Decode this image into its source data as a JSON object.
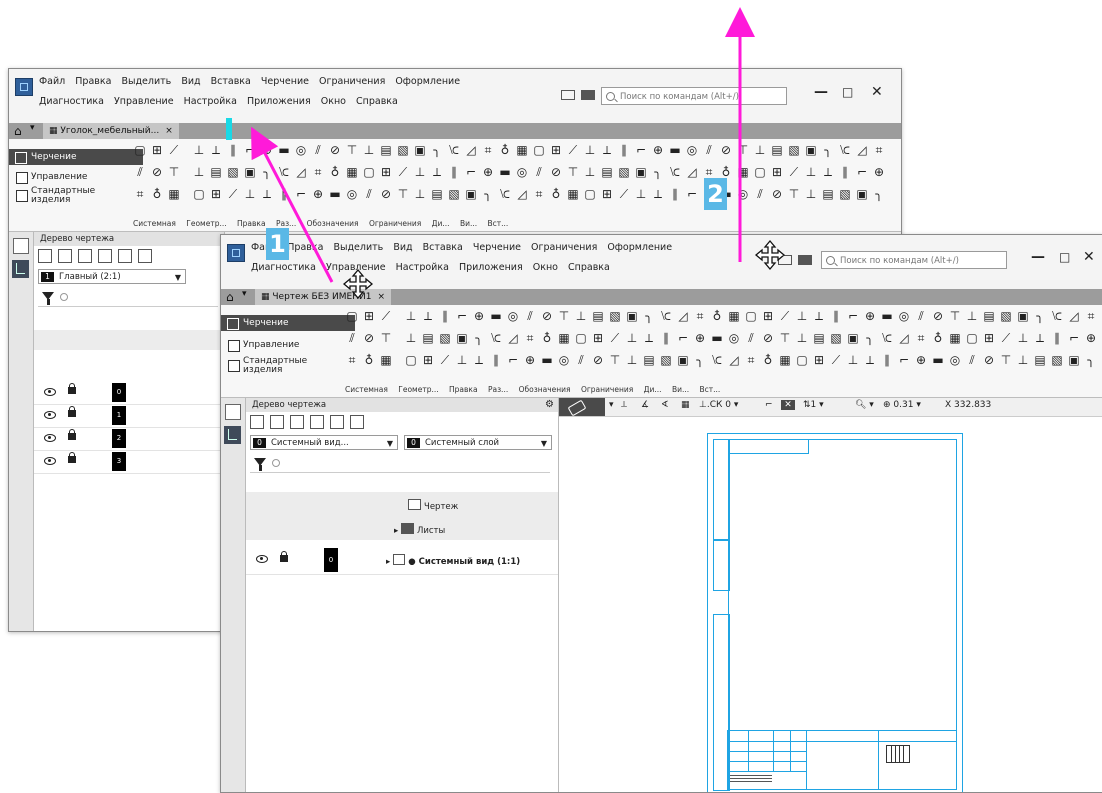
{
  "colors": {
    "arrow": "#ff1ad9",
    "badge": "#5ab8e6",
    "drop_marker": "#19d9e6",
    "sheet_border": "#1fa4e3",
    "tabbar": "#9c9c9c"
  },
  "window_back": {
    "menu_row1": [
      "Файл",
      "Правка",
      "Выделить",
      "Вид",
      "Вставка",
      "Черчение",
      "Ограничения",
      "Оформление"
    ],
    "menu_row2": [
      "Диагностика",
      "Управление",
      "Настройка",
      "Приложения",
      "Окно",
      "Справка"
    ],
    "search_placeholder": "Поиск по командам (Alt+/)",
    "tab_label": "Уголок_мебельный...",
    "tab_close": "×",
    "ribbon_items": [
      "Черчение",
      "Управление",
      "Стандартные изделия"
    ],
    "group_labels": [
      "Системная",
      "Геометр...",
      "Правка",
      "Раз...",
      "Обозначения",
      "Ограничения",
      "Ди...",
      "Ви...",
      "Вст..."
    ],
    "panel_title": "Дерево чертежа",
    "layer_view": "Главный (2:1)",
    "layer_view_num": "1",
    "layer_nums": [
      "0",
      "1",
      "2",
      "3"
    ]
  },
  "window_front": {
    "menu_row1": [
      "Файл",
      "Правка",
      "Выделить",
      "Вид",
      "Вставка",
      "Черчение",
      "Ограничения",
      "Оформление"
    ],
    "menu_row2": [
      "Диагностика",
      "Управление",
      "Настройка",
      "Приложения",
      "Окно",
      "Справка"
    ],
    "search_placeholder": "Поиск по командам (Alt+/)",
    "tab_label": "Чертеж БЕЗ ИМЕНИ1",
    "tab_close": "×",
    "ribbon_items": [
      "Черчение",
      "Управление",
      "Стандартные изделия"
    ],
    "group_labels": [
      "Системная",
      "Геометр...",
      "Правка",
      "Раз...",
      "Обозначения",
      "Ограничения",
      "Ди...",
      "Ви...",
      "Вст..."
    ],
    "panel_title": "Дерево чертежа",
    "view_select": "Системный вид...",
    "view_select_num": "0",
    "layer_select": "Системный слой",
    "layer_select_num": "0",
    "tree_root": "Чертеж",
    "tree_sheets": "Листы",
    "row_label": "Системный вид (1:1)",
    "row_num": "0",
    "view_toolbar": {
      "cs": "СК 0",
      "scale_num": "1",
      "zoom": "0.31",
      "coord": "X 332.833"
    }
  },
  "annotations": {
    "badge1": "1",
    "badge2": "2"
  }
}
